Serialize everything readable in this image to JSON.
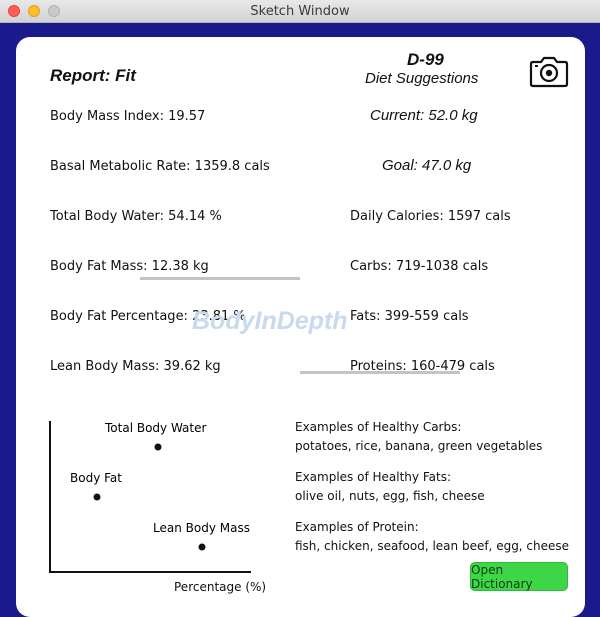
{
  "window": {
    "title": "Sketch Window"
  },
  "report": {
    "title": "Report: Fit",
    "id_code": "D-99",
    "metrics": [
      "Body Mass Index: 19.57",
      "Basal Metabolic Rate: 1359.8 cals",
      "Total Body Water: 54.14 %",
      "Body Fat Mass: 12.38 kg",
      "Body Fat Percentage: 23.81 %",
      "Lean Body Mass: 39.62 kg"
    ],
    "watermark": "BodyInDepth"
  },
  "diet": {
    "title": "Diet Suggestions",
    "current_weight": "Current: 52.0 kg",
    "goal_weight": "Goal: 47.0 kg",
    "daily_calories": "Daily Calories: 1597 cals",
    "carbs": "Carbs: 719-1038 cals",
    "fats": "Fats: 399-559 cals",
    "proteins": "Proteins: 160-479 cals"
  },
  "chart_data": {
    "type": "scatter",
    "xlabel": "Percentage (%)",
    "points": [
      {
        "label": "Total Body Water"
      },
      {
        "label": "Body Fat"
      },
      {
        "label": "Lean Body Mass"
      }
    ]
  },
  "examples": [
    {
      "heading": "Examples of Healthy Carbs:",
      "items": "potatoes, rice, banana, green vegetables"
    },
    {
      "heading": "Examples of Healthy Fats:",
      "items": "olive oil, nuts, egg, fish, cheese"
    },
    {
      "heading": "Examples of Protein:",
      "items": "fish, chicken, seafood, lean beef, egg, cheese"
    }
  ],
  "buttons": {
    "open_dictionary": "Open Dictionary"
  },
  "icons": {
    "camera": "camera-icon"
  },
  "colors": {
    "background": "#1a1a8c",
    "button": "#3dd647",
    "watermark": "#c9d9ee"
  }
}
